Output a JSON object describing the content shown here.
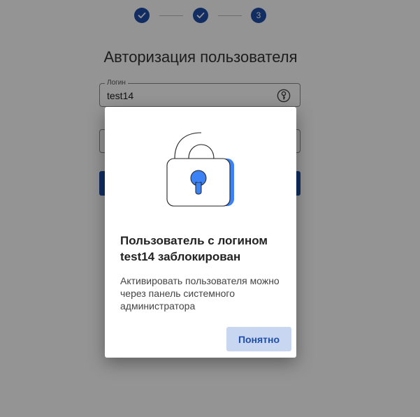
{
  "stepper": {
    "steps": [
      {
        "state": "done",
        "icon": "check-icon"
      },
      {
        "state": "done",
        "icon": "check-icon"
      },
      {
        "state": "current",
        "label": "3"
      }
    ]
  },
  "form": {
    "title": "Авторизация пользователя",
    "login_label": "Логин",
    "login_value": "test14",
    "key_icon": "key-icon"
  },
  "dialog": {
    "illustration": "lock-icon",
    "title": "Пользователь с логином test14 заблокирован",
    "text": "Активировать пользователя можно через панель системного администратора",
    "ok_label": "Понятно"
  },
  "colors": {
    "accent": "#1e4fa8",
    "button_light": "#c9d6f2",
    "lock_blue": "#3b82f6"
  }
}
